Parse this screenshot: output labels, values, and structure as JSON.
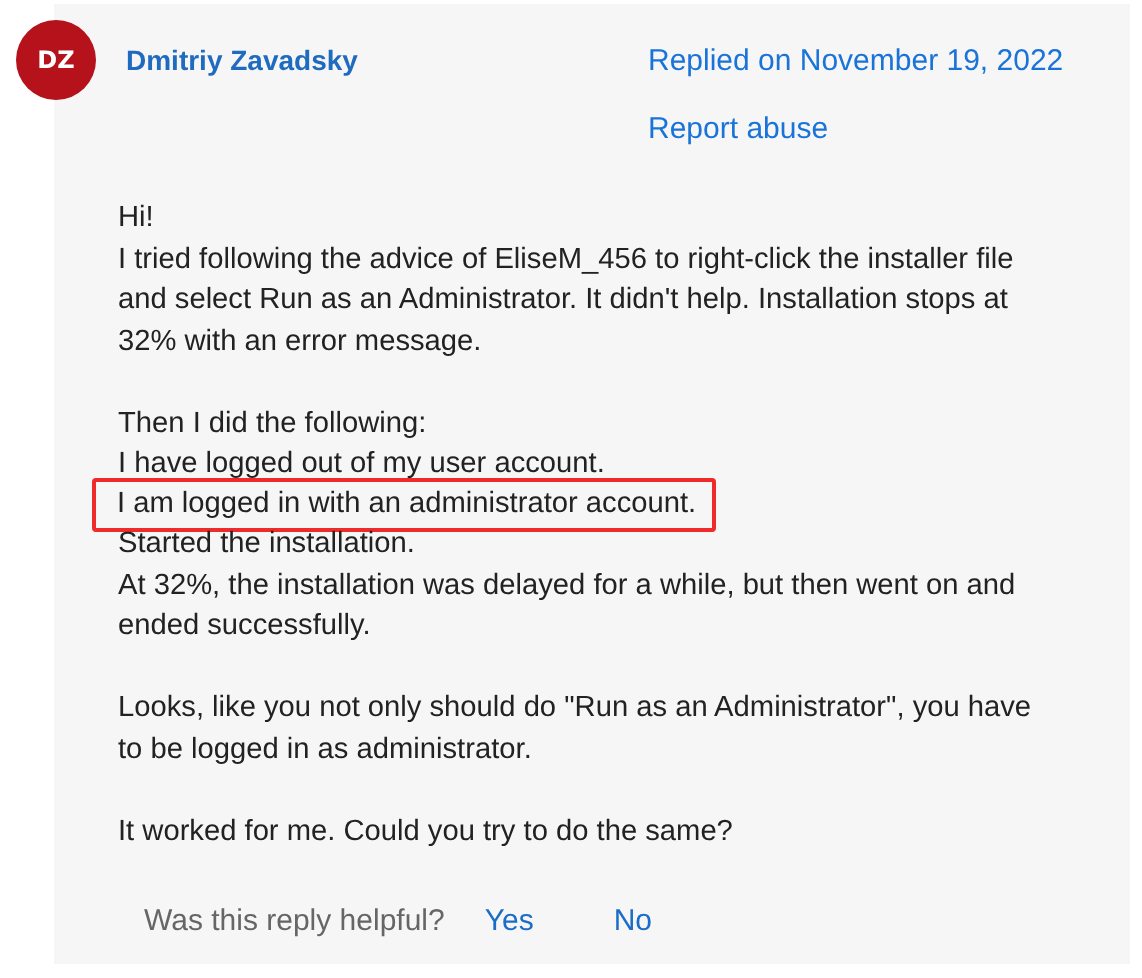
{
  "author": {
    "initials": "DZ",
    "name": "Dmitriy Zavadsky"
  },
  "replied": "Replied on November 19, 2022",
  "report": "Report abuse",
  "paragraphs": [
    [
      {
        "text": "Hi!",
        "highlighted": false
      },
      {
        "text": "I tried following the advice of EliseM_456 to right-click the installer file",
        "highlighted": false
      },
      {
        "text": "and select Run as an Administrator.  It didn't help. Installation stops at",
        "highlighted": false
      },
      {
        "text": "32% with an error message.",
        "highlighted": false
      }
    ],
    [
      {
        "text": "Then I did the following:",
        "highlighted": false
      },
      {
        "text": "I have logged out of my user account.",
        "highlighted": false
      },
      {
        "text": "I am logged in with an administrator account.",
        "highlighted": true
      },
      {
        "text": "Started the installation.",
        "highlighted": false
      },
      {
        "text": "At 32%, the installation was delayed for a while, but then went on and",
        "highlighted": false
      },
      {
        "text": "ended successfully.",
        "highlighted": false
      }
    ],
    [
      {
        "text": "Looks, like you not only should do \"Run as an Administrator\", you have",
        "highlighted": false
      },
      {
        "text": "to be logged in as administrator.",
        "highlighted": false
      }
    ],
    [
      {
        "text": "It worked for me. Could you try to do the same?",
        "highlighted": false
      }
    ]
  ],
  "helpful": {
    "question": "Was this reply helpful?",
    "yes": "Yes",
    "no": "No"
  }
}
